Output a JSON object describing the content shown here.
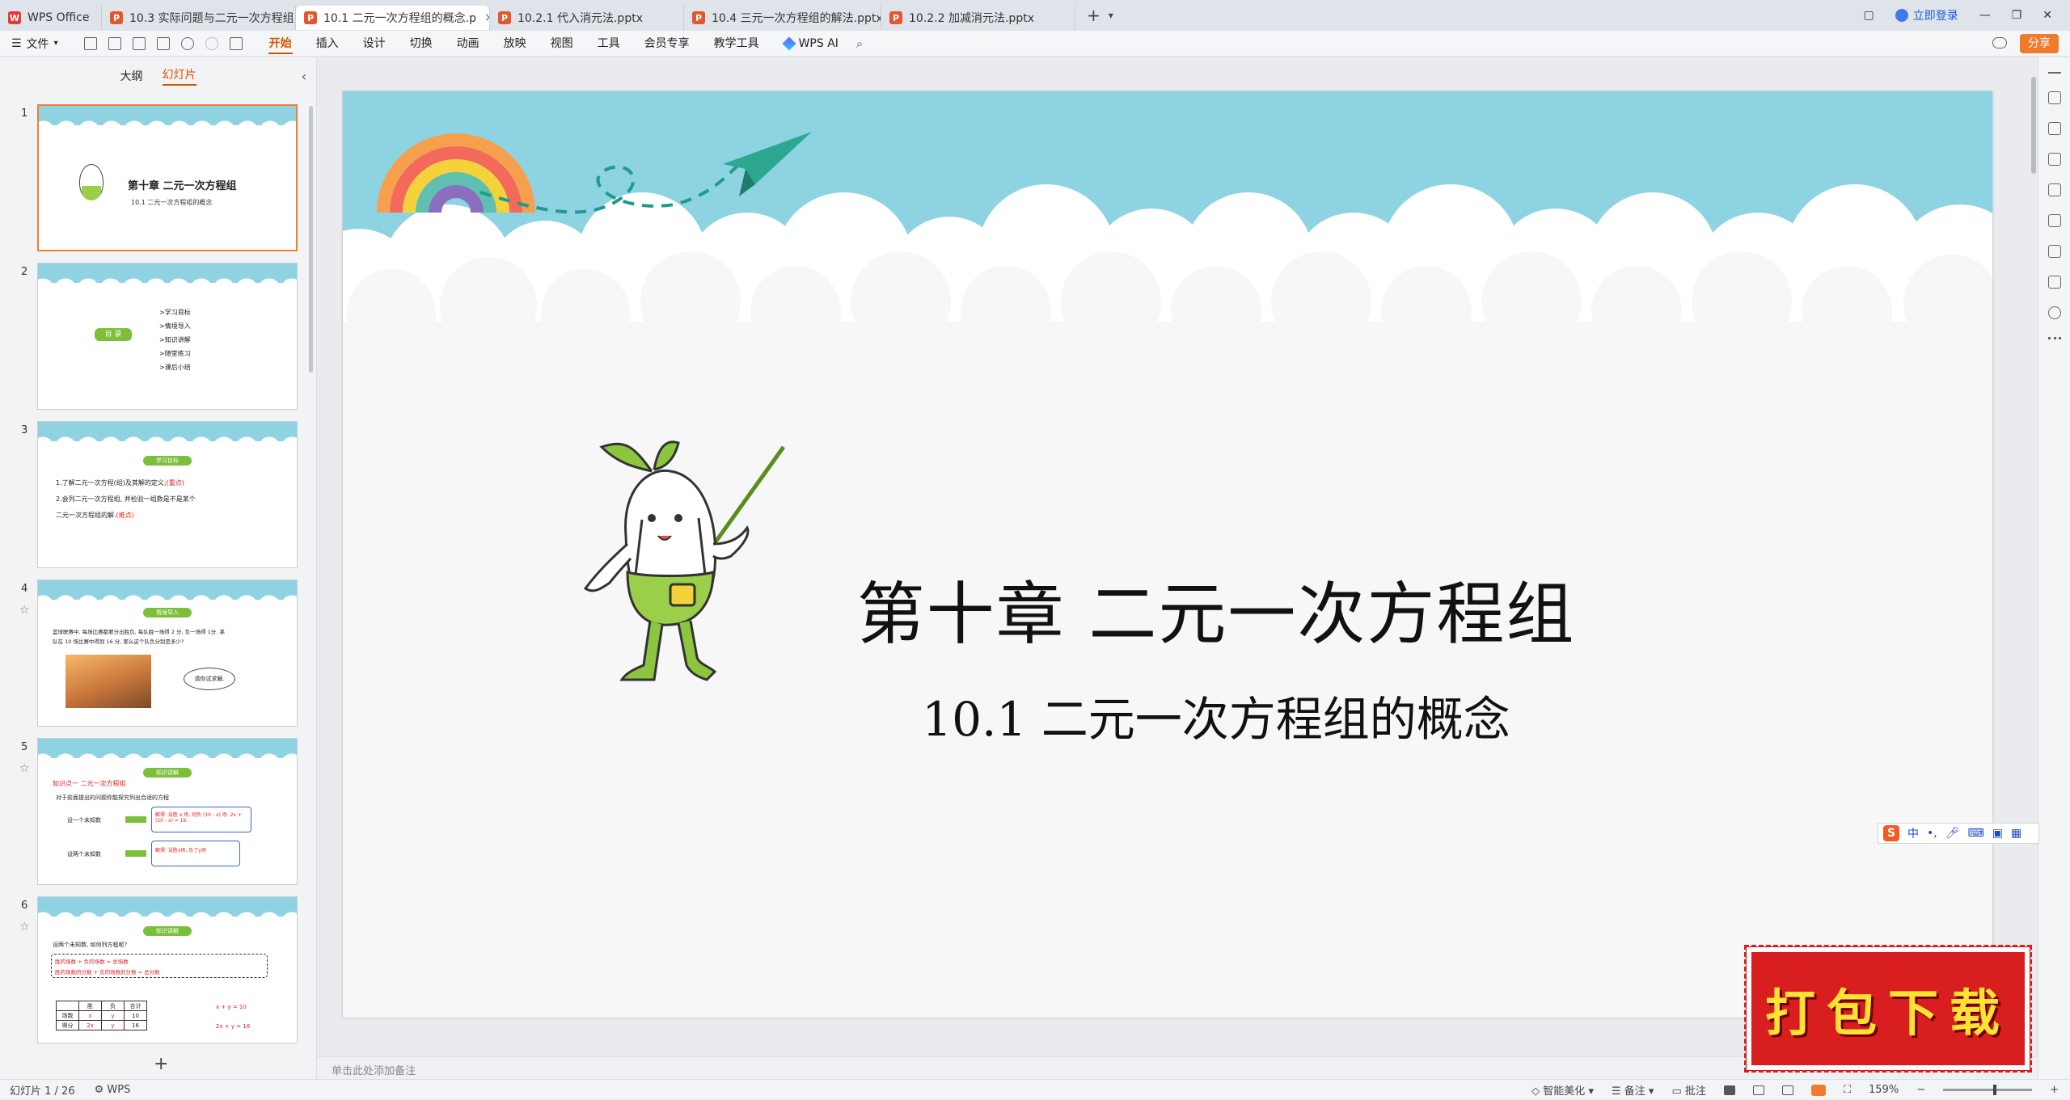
{
  "tabs": [
    {
      "label": "WPS Office",
      "icon": "wps-logo-icon",
      "active": false
    },
    {
      "label": "10.3  实际问题与二元一次方程组",
      "active": false
    },
    {
      "label": "10.1 二元一次方程组的概念.p",
      "active": true
    },
    {
      "label": "10.2.1 代入消元法.pptx",
      "active": false
    },
    {
      "label": "10.4  三元一次方程组的解法.pptx",
      "active": false
    },
    {
      "label": "10.2.2 加减消元法.pptx",
      "active": false
    }
  ],
  "titlebar": {
    "login_label": "立即登录"
  },
  "menu": {
    "file_label": "文件",
    "items": [
      "开始",
      "插入",
      "设计",
      "切换",
      "动画",
      "放映",
      "视图",
      "工具",
      "会员专享",
      "教学工具"
    ],
    "active": "开始",
    "wps_ai_label": "WPS AI",
    "share_label": "分享"
  },
  "left_panel": {
    "tab_outline": "大纲",
    "tab_slides": "幻灯片",
    "add_symbol": "+"
  },
  "thumbs": {
    "s1": {
      "num": "1",
      "title": "第十章  二元一次方程组",
      "subtitle": "10.1  二元一次方程组的概念"
    },
    "s2": {
      "num": "2",
      "pill": "目  录",
      "toc": [
        ">学习目标",
        ">情境导入",
        ">知识讲解",
        ">随堂练习",
        ">课后小结"
      ]
    },
    "s3": {
      "num": "3",
      "pill": "学习目标",
      "l1": "1.了解二元一次方程(组)及其解的定义;",
      "l1r": "(重点)",
      "l2": "2.会列二元一次方程组, 并检验一组数是不是某个",
      "l3": "二元一次方程组的解.",
      "l3r": "(难点)"
    },
    "s4": {
      "num": "4",
      "pill": "情境导入",
      "l1": "篮球联赛中, 每场比赛都要分出胜负, 每队胜一场得 2 分, 负一场得 1分. 某",
      "l2": "队在 10 场比赛中得到 16 分, 那么这个队负分别是多少?",
      "bubble": "请你试求解."
    },
    "s5": {
      "num": "5",
      "pill": "知识讲解",
      "k": "知识点一  二元一次方程组",
      "q": "对于前面提出的问题你能探究列出合适的方程",
      "a1": "设一个未知数",
      "a2": "设两个未知数",
      "b1": "解得: 设胜 x 场, 则负 (10 - x) 场. 2x + (10 - x) = 16.",
      "b2": "解得: 设胜x场, 负了y场"
    },
    "s6": {
      "num": "6",
      "pill": "知识讲解",
      "q": "设两个未知数, 如何列方程呢?",
      "r1": "胜的场数 + 负的场数 = 总场数",
      "r2": "胜的场数的分数 + 负的场数的分数 = 总分数",
      "h": [
        "",
        "胜",
        "负",
        "合计"
      ],
      "row1": [
        "场数",
        "x",
        "y",
        "10"
      ],
      "row2": [
        "得分",
        "2x",
        "y",
        "16"
      ],
      "e1": "x + y = 10",
      "e2": "2x + y = 16"
    }
  },
  "slide": {
    "title": "第十章  二元一次方程组",
    "subtitle": "10.1  二元一次方程组的概念"
  },
  "notes_placeholder": "单击此处添加备注",
  "ime": {
    "cn": "中"
  },
  "badge_text": "打包下载",
  "status": {
    "slide_info": "幻灯片 1 / 26",
    "app": "WPS",
    "beautify": "智能美化",
    "notes": "备注",
    "comment": "批注",
    "zoom": "159%"
  }
}
